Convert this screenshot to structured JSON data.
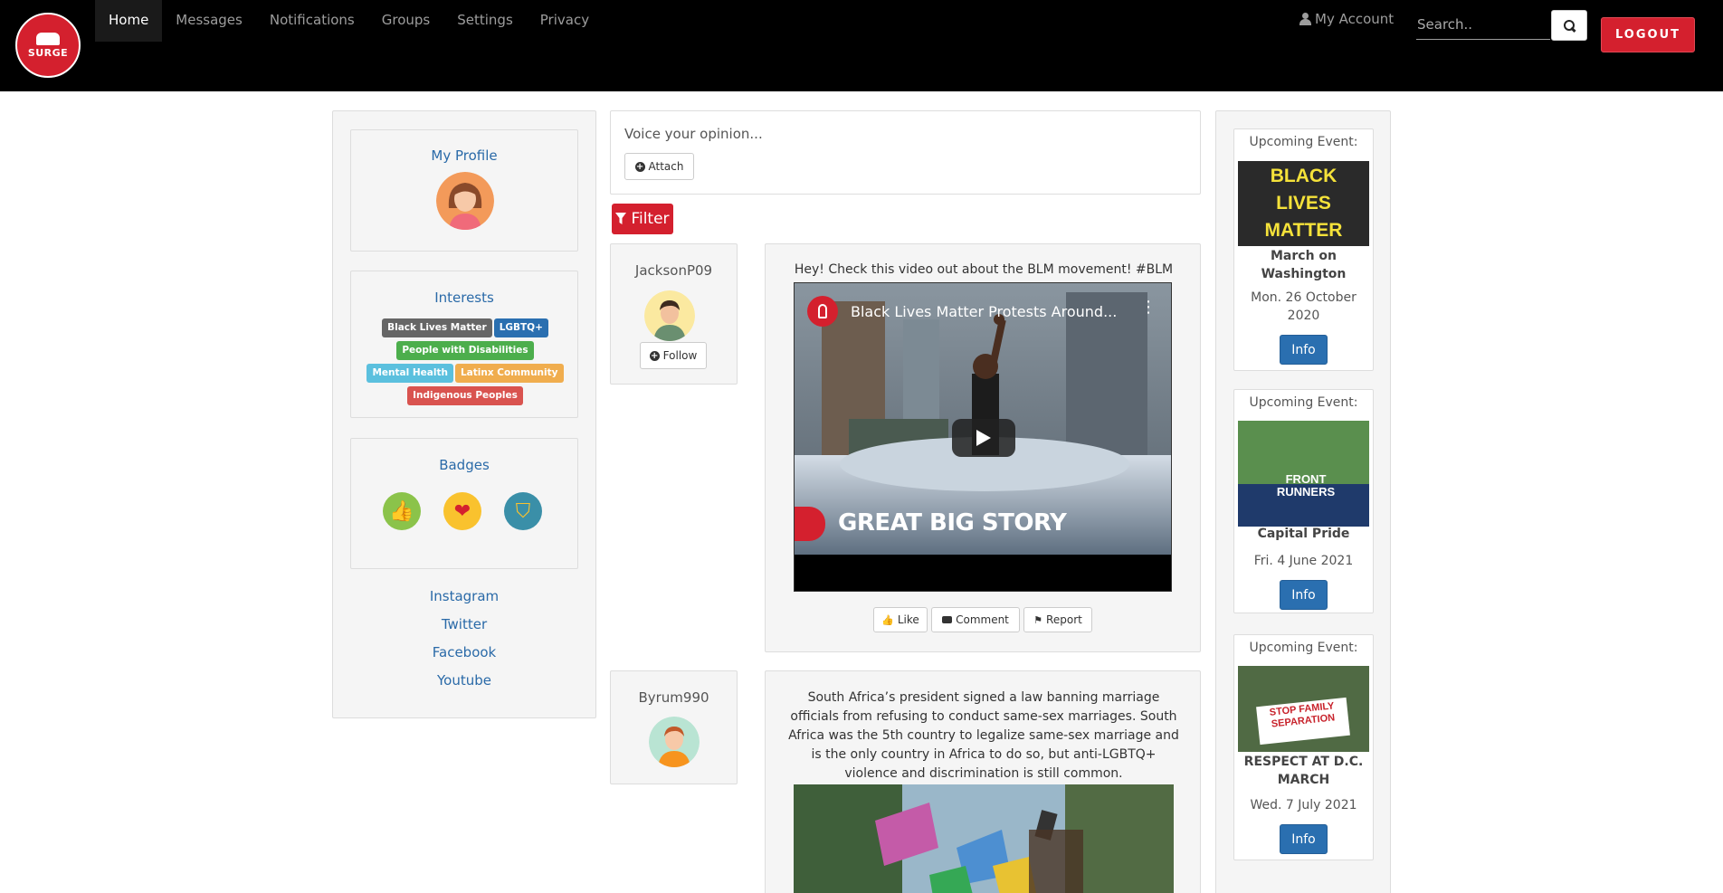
{
  "brand": {
    "logo_text": "SURGE"
  },
  "nav": {
    "items": [
      {
        "label": "Home",
        "active": true
      },
      {
        "label": "Messages"
      },
      {
        "label": "Notifications"
      },
      {
        "label": "Groups"
      },
      {
        "label": "Settings"
      },
      {
        "label": "Privacy"
      }
    ],
    "account_label": "My Account",
    "search_placeholder": "Search..",
    "logout_label": "LOGOUT"
  },
  "sidebar": {
    "profile_title": "My Profile",
    "interests_title": "Interests",
    "interests": [
      {
        "label": "Black Lives Matter",
        "color": "#666666"
      },
      {
        "label": "LGBTQ+",
        "color": "#2a6fb0"
      },
      {
        "label": "People with Disabilities",
        "color": "#4cae4c"
      },
      {
        "label": "Mental Health",
        "color": "#5bc0de"
      },
      {
        "label": "Latinx Community",
        "color": "#f0ad4e"
      },
      {
        "label": "Indigenous Peoples",
        "color": "#d9534f"
      }
    ],
    "badges_title": "Badges",
    "badges": [
      {
        "icon": "thumbs-up-icon",
        "glyph": "👍",
        "color": "#8bc34a"
      },
      {
        "icon": "heart-icon",
        "glyph": "❤",
        "color": "#f9c22e"
      },
      {
        "icon": "shield-icon",
        "glyph": "🛡",
        "color": "#3a8fa8"
      }
    ],
    "social": [
      "Instagram",
      "Twitter",
      "Facebook",
      "Youtube"
    ]
  },
  "composer": {
    "placeholder": "Voice your opinion...",
    "attach_label": "Attach",
    "filter_label": "Filter"
  },
  "posts": [
    {
      "username": "JacksonP09",
      "follow_label": "Follow",
      "text": "Hey! Check this video out about the BLM movement! #BLM",
      "video_title": "Black Lives Matter Protests Around...",
      "video_brand": "GREAT BIG STORY",
      "like_label": "Like",
      "comment_label": "Comment",
      "report_label": "Report"
    },
    {
      "username": "Byrum990",
      "text": "South Africa’s president signed a law banning marriage officials from refusing to conduct same-sex marriages. South Africa was the 5th country to legalize same-sex marriage and is the only country in Africa to do so, but anti-LGBTQ+ violence and discrimination is still common."
    }
  ],
  "events": [
    {
      "heading": "Upcoming Event:",
      "image_text": "BLACK LIVES MATTER",
      "title": "March on Washington",
      "date": "Mon. 26 October 2020",
      "button": "Info"
    },
    {
      "heading": "Upcoming Event:",
      "image_text": "FRONT RUNNERS",
      "title": "Capital Pride",
      "date": "Fri. 4 June 2021",
      "button": "Info"
    },
    {
      "heading": "Upcoming Event:",
      "image_text": "STOP FAMILY SEPARATION",
      "title": "RESPECT AT D.C. MARCH",
      "date": "Wed. 7 July 2021",
      "button": "Info"
    }
  ]
}
